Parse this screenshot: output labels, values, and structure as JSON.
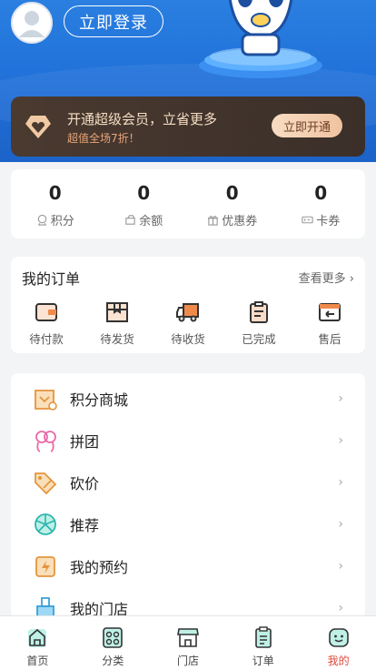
{
  "header": {
    "login_label": "立即登录"
  },
  "vip": {
    "title": "开通超级会员，立省更多",
    "subtitle": "超值全场7折！",
    "button": "立即开通"
  },
  "stats": [
    {
      "value": "0",
      "label": "积分",
      "icon": "points-icon"
    },
    {
      "value": "0",
      "label": "余额",
      "icon": "balance-icon"
    },
    {
      "value": "0",
      "label": "优惠券",
      "icon": "gift-icon"
    },
    {
      "value": "0",
      "label": "卡券",
      "icon": "ticket-icon"
    }
  ],
  "orders": {
    "title": "我的订单",
    "more": "查看更多 ›",
    "items": [
      {
        "label": "待付款",
        "icon": "wallet-icon"
      },
      {
        "label": "待发货",
        "icon": "package-icon"
      },
      {
        "label": "待收货",
        "icon": "truck-icon"
      },
      {
        "label": "已完成",
        "icon": "clipboard-check-icon"
      },
      {
        "label": "售后",
        "icon": "return-icon"
      }
    ]
  },
  "menu": [
    {
      "label": "积分商城",
      "icon": "points-mall-icon"
    },
    {
      "label": "拼团",
      "icon": "group-buy-icon"
    },
    {
      "label": "砍价",
      "icon": "bargain-icon"
    },
    {
      "label": "推荐",
      "icon": "recommend-icon"
    },
    {
      "label": "我的预约",
      "icon": "appointment-icon"
    },
    {
      "label": "我的门店",
      "icon": "store-icon"
    }
  ],
  "tabbar": [
    {
      "label": "首页",
      "icon": "home-icon"
    },
    {
      "label": "分类",
      "icon": "category-icon"
    },
    {
      "label": "门店",
      "icon": "shop-icon"
    },
    {
      "label": "订单",
      "icon": "order-icon"
    },
    {
      "label": "我的",
      "icon": "profile-icon",
      "active": true
    }
  ],
  "colors": {
    "header_blue": "#1f6fd8",
    "vip_bg": "#3b2f29",
    "vip_gold": "#f4dcc2",
    "accent_orange": "#f08a4b",
    "accent_teal": "#2bb5b0",
    "active_red": "#e24a3b"
  }
}
